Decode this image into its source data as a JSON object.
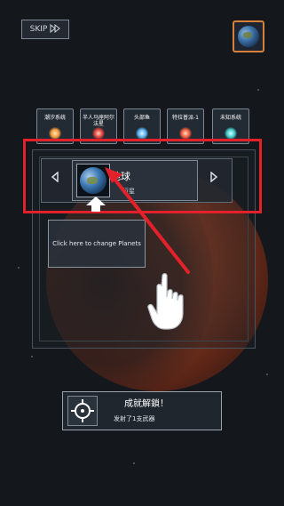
{
  "header": {
    "skip_label": "SKIP",
    "skip_icon": "fast-forward-icon",
    "current_planet_icon": "earth-icon"
  },
  "systems": [
    {
      "label": "潮汐系统",
      "color": "#d86a22"
    },
    {
      "label": "半人马座阿尔法星",
      "color": "#c22b2b"
    },
    {
      "label": "头部鱼",
      "color": "#2f8bd6"
    },
    {
      "label": "特拉普派-1",
      "color": "#d43a2a"
    },
    {
      "label": "未知系统",
      "color": "#2a8f8f"
    }
  ],
  "planet_selector": {
    "prev_icon": "triangle-left-icon",
    "next_icon": "triangle-right-icon",
    "name": "地球",
    "type": "行星",
    "thumb_icon": "earth-icon"
  },
  "change_planet": {
    "label": "Click here to change Planets"
  },
  "tutorial": {
    "up_arrow_icon": "up-arrow-icon",
    "hand_icon": "pointing-hand-icon",
    "highlight_color": "#e3212b"
  },
  "achievement": {
    "icon": "crosshair-icon",
    "title": "成就解鎖！",
    "subtitle": "发射了1支武器"
  }
}
